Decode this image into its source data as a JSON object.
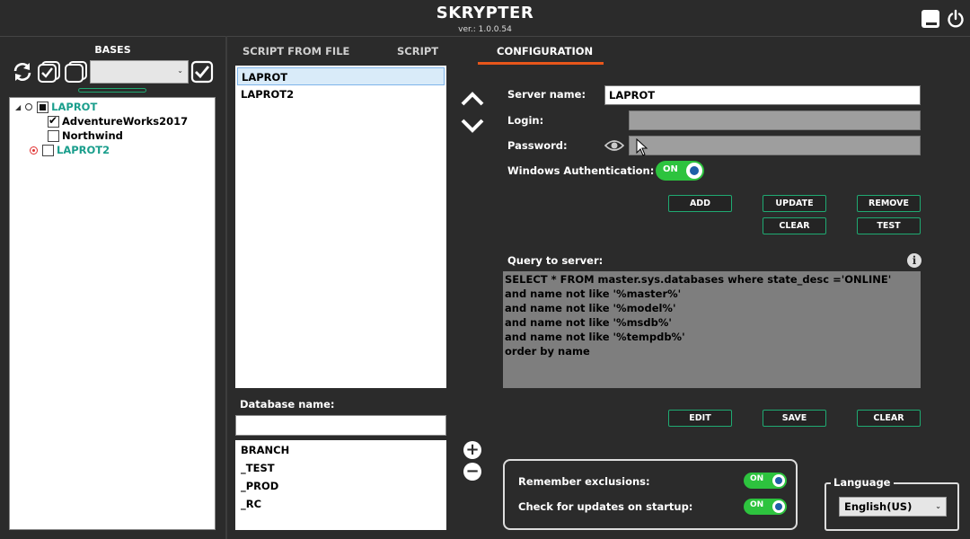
{
  "app": {
    "title": "SKRYPTER",
    "version": "ver.: 1.0.0.54"
  },
  "bases": {
    "title": "BASES",
    "dropdown_value": "",
    "tree": [
      {
        "label": "LAPROT",
        "children": [
          "AdventureWorks2017",
          "Northwind"
        ]
      },
      {
        "label": "LAPROT2"
      }
    ]
  },
  "tabs": [
    "SCRIPT FROM FILE",
    "SCRIPT",
    "CONFIGURATION"
  ],
  "scripts_list": [
    "LAPROT",
    "LAPROT2"
  ],
  "database": {
    "label": "Database name:",
    "input_value": "",
    "items": [
      "BRANCH",
      "_TEST",
      "_PROD",
      "_RC"
    ]
  },
  "config": {
    "server_name_label": "Server name:",
    "server_name_value": "LAPROT",
    "login_label": "Login:",
    "login_value": "",
    "password_label": "Password:",
    "password_value": "",
    "windows_auth_label": "Windows Authentication:",
    "windows_auth_state": "ON",
    "buttons": {
      "add": "ADD",
      "update": "UPDATE",
      "remove": "REMOVE",
      "clear": "CLEAR",
      "test": "TEST"
    },
    "query_label": "Query to server:",
    "query_lines": [
      "SELECT * FROM master.sys.databases where state_desc ='ONLINE'",
      "and name not like '%master%'",
      "and name not like '%model%'",
      "and name not like '%msdb%'",
      "and name not like '%tempdb%'",
      "order by name"
    ],
    "query_buttons": {
      "edit": "EDIT",
      "save": "SAVE",
      "clear": "CLEAR"
    }
  },
  "settings": {
    "remember_label": "Remember exclusions:",
    "remember_state": "ON",
    "updates_label": "Check for updates on startup:",
    "updates_state": "ON"
  },
  "language": {
    "title": "Language",
    "value": "English(US)"
  },
  "colors": {
    "accent_green": "#1faa72",
    "toggle_green": "#2dc33e",
    "tab_underline": "#e8561b",
    "teal_text": "#1a9e8c",
    "background": "#2b2b2b"
  }
}
